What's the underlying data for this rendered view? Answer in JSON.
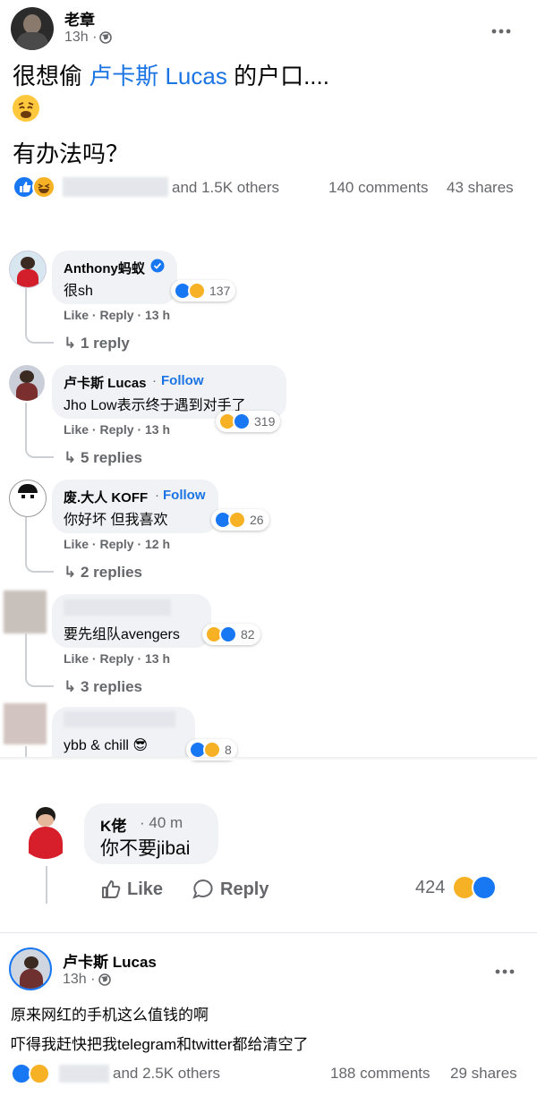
{
  "post1": {
    "author": "老章",
    "time": "13h ·",
    "text_line1_a": "很想偷 ",
    "text_line1_link": "卢卡斯 Lucas",
    "text_line1_b": " 的户口....",
    "text_line3": "有办法吗？",
    "reactions_others": "and 1.5K others",
    "comments": "140 comments",
    "shares": "43 shares"
  },
  "comments": [
    {
      "name": "Anthony蚂蚁",
      "text": "很sh",
      "actions": "Like · Reply · 13 h",
      "reaction_count": "137",
      "replies": "1 reply"
    },
    {
      "name": "卢卡斯 Lucas",
      "follow": "Follow",
      "text": "Jho Low表示终于遇到对手了",
      "actions": "Like · Reply · 13 h",
      "reaction_count": "319",
      "replies": "5 replies"
    },
    {
      "name": "废.大人 KOFF",
      "follow": "Follow",
      "text": "你好坏 但我喜欢",
      "actions": "Like · Reply · 12 h",
      "reaction_count": "26",
      "replies": "2 replies"
    },
    {
      "name": "",
      "text": "要先组队avengers",
      "actions": "Like · Reply · 13 h",
      "reaction_count": "82",
      "replies": "3 replies"
    },
    {
      "name": "",
      "text": "ybb & chill 😎",
      "reaction_count": "8"
    }
  ],
  "kcomment": {
    "name": "K佬",
    "time": "· 40 m",
    "text": "你不要jibai",
    "like": "Like",
    "reply": "Reply",
    "reaction_count": "424"
  },
  "post2": {
    "author": "卢卡斯 Lucas",
    "time": "13h ·",
    "line1": "原来网红的手机这么值钱的啊",
    "line2": "吓得我赶快把我telegram和twitter都给清空了",
    "reactions_others": "and 2.5K others",
    "comments": "188 comments",
    "shares": "29 shares"
  },
  "icons": {
    "globe": "globe-icon",
    "more": "more-options-icon",
    "like": "like-reaction-icon",
    "haha": "haha-reaction-icon",
    "reply_arrow": "reply-arrow-icon",
    "verified": "verified-badge-icon"
  },
  "colors": {
    "link": "#1b74e4",
    "like": "#1877f2",
    "haha": "#f7b125",
    "meta": "#65676b",
    "bubble": "#f0f2f5"
  }
}
